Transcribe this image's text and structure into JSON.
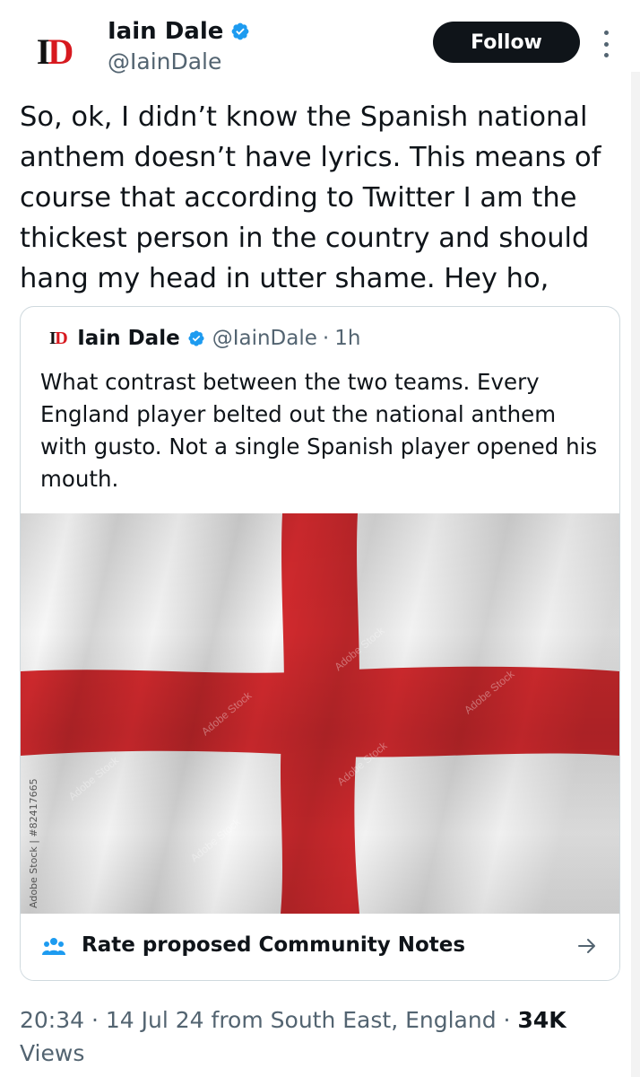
{
  "author": {
    "avatar_letters": "ID",
    "name": "Iain Dale",
    "handle": "@IainDale",
    "verified": true
  },
  "follow_label": "Follow",
  "tweet_text": "So, ok, I didn’t know the Spanish national anthem doesn’t have lyrics. This means of course that according to Twitter I am the thickest person in the country and should hang my head in utter shame. Hey ho,",
  "quoted_tweet": {
    "avatar_letters": "ID",
    "name": "Iain Dale",
    "handle": "@IainDale",
    "separator": "·",
    "time": "1h",
    "text": "What contrast between the two teams. Every England player belted out the national anthem with gusto. Not a single Spanish player opened his mouth.",
    "image_credit": "Adobe Stock | #82417665",
    "watermark": "Adobe Stock"
  },
  "community_notes_label": "Rate proposed Community Notes",
  "meta": {
    "time": "20:34",
    "sep1": " · ",
    "date": "14 Jul 24",
    "location": " from South East, England",
    "sep2": " · ",
    "views_count": "34K",
    "views_label": "Views"
  },
  "colors": {
    "follow_bg": "#0f1419",
    "verified_blue": "#1d9bf0",
    "secondary_text": "#536471",
    "flag_red": "#d32a2e",
    "logo_red": "#d7191f"
  },
  "icons": [
    "verified-badge-icon",
    "more-options-icon",
    "community-notes-icon",
    "arrow-right-icon"
  ]
}
